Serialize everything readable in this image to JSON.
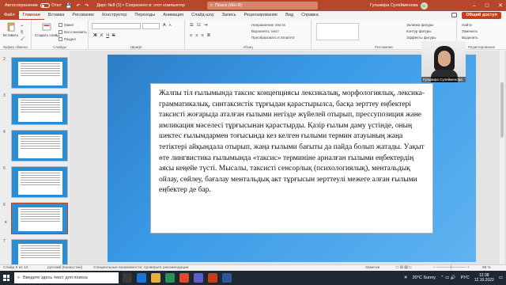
{
  "titlebar": {
    "autosave": "Автосохранение",
    "autosave_state": "Откл",
    "document": "Дирс №8 (1) • Сохранено в: этот компьютер",
    "search_placeholder": "Поиск (Alt+Я)",
    "user_name": "Гульмира Сулейменова",
    "user_initials": "ГС"
  },
  "tabs": [
    "Файл",
    "Главная",
    "Вставка",
    "Рисование",
    "Конструктор",
    "Переходы",
    "Анимация",
    "Слайд-шоу",
    "Запись",
    "Рецензирование",
    "Вид",
    "Справка"
  ],
  "active_tab": "Главная",
  "share_label": "Общий доступ",
  "ribbon": {
    "paste": "Вставить",
    "clipboard": "Буфер обмена",
    "new_slide": "Создать слайд",
    "layout": "Макет",
    "reset": "Восстановить",
    "section": "Раздел",
    "slides": "Слайды",
    "font": "Шрифт",
    "paragraph": "Абзац",
    "text_direction": "Направление текста",
    "align_text": "Выровнять текст",
    "convert_smartart": "Преобразовать в SmartArt",
    "drawing": "Рисование",
    "shape_fill": "Заливка фигуры",
    "shape_outline": "Контур фигуры",
    "shape_effects": "Эффекты фигуры",
    "find": "Найти",
    "replace": "Заменить",
    "select": "Выделить",
    "editing": "Редактирование",
    "bold": "Ж",
    "italic": "К",
    "underline": "Ч",
    "strike": "S",
    "font_size_up": "A",
    "font_size_down": "A"
  },
  "thumbnails": [
    {
      "num": "2"
    },
    {
      "num": "3"
    },
    {
      "num": "4"
    },
    {
      "num": "5"
    },
    {
      "num": "6"
    },
    {
      "num": "7"
    }
  ],
  "selected_thumbnail": "6",
  "slide_text": "Жалпы тіл ғылымында таксис концепциясы лексикалық, морфологиялық, лексика-грамматикалық, синтаксистік тұрғыдан қарастырылса, басқа зерттеу еңбектері таксисті жоғарыда аталған ғылыми негізде жүйелей отырып, прессупозиция және имликация мәселесі тұрғысынан қарастырды. Қазір ғылым даму үстінде, оның шектес ғылымдармен тоғысында кез келген ғылыми термин атауының жаңа тетіктері айқындала отырып, жаңа ғылыми бағыты да пайда болып жатады. Уақыт өте лингвистика ғылымында «таксис» терминіне арналған ғылыми еңбектердің аясы кеңейе түсті. Мысалы, таксисті сенсорлық (психологиялық), ментальдық ойлау, сөйлеу, бағалау ментальдық акт тұрғысын зерттеулі межеге алған ғылыми еңбектер де бар.",
  "webcam_name": "Гульмира Сулейменова",
  "statusbar": {
    "slide_info": "Слайд 6 из 12",
    "language": "русский (Казахстан)",
    "accessibility": "Специальные возможности: проверьте рекомендации",
    "notes": "Заметки",
    "zoom": "86 %"
  },
  "taskbar": {
    "search_placeholder": "Введите здесь текст для поиска",
    "weather": "20°C Sunny",
    "lang": "РУС",
    "time": "12:38",
    "date": "12.10.2022"
  }
}
